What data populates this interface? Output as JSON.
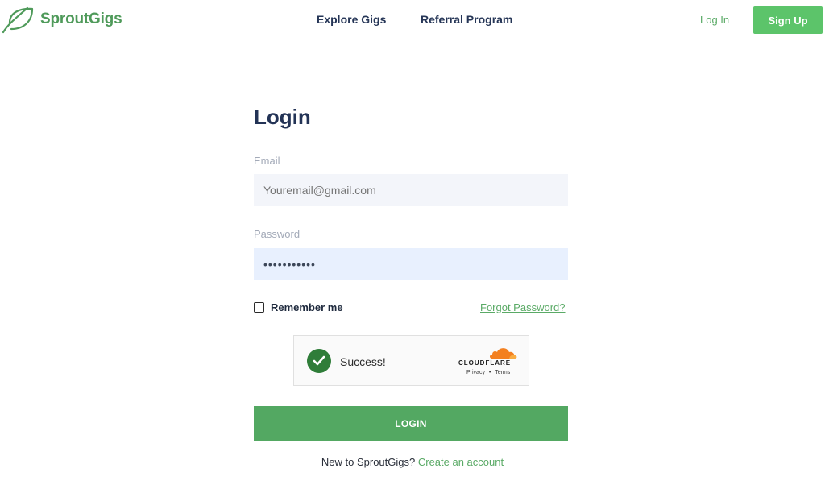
{
  "header": {
    "brand": "SproutGigs",
    "nav": {
      "explore": "Explore Gigs",
      "referral": "Referral Program"
    },
    "login_link": "Log In",
    "signup_button": "Sign Up"
  },
  "form": {
    "title": "Login",
    "email_label": "Email",
    "email_placeholder": "Youremail@gmail.com",
    "password_label": "Password",
    "password_value": "•••••••••••",
    "remember_label": "Remember me",
    "forgot_link": "Forgot Password?",
    "captcha": {
      "status": "Success!",
      "provider": "CLOUDFLARE",
      "privacy": "Privacy",
      "separator": "•",
      "terms": "Terms"
    },
    "login_button": "LOGIN",
    "signup_prompt": "New to SproutGigs?",
    "create_account_link": "Create an account"
  },
  "colors": {
    "brand_green": "#4f9a5a",
    "button_green": "#53a862",
    "signup_green": "#5cc46a",
    "cloudflare_orange": "#f38020",
    "captcha_check": "#2f7d39"
  }
}
